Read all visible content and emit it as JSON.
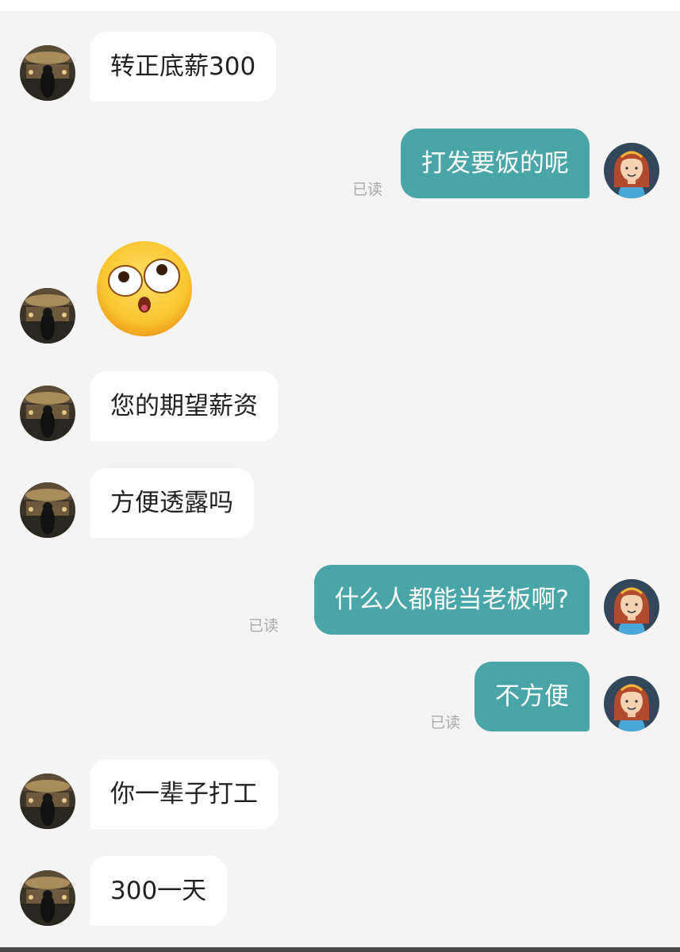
{
  "chat": {
    "read_label": "已读",
    "messages": [
      {
        "sender": "other",
        "text": "转正底薪300"
      },
      {
        "sender": "me",
        "text": "打发要饭的呢",
        "status": "已读"
      },
      {
        "sender": "other",
        "sticker": "eyes-rolling-surprised-face"
      },
      {
        "sender": "other",
        "text": "您的期望薪资"
      },
      {
        "sender": "other",
        "text": "方便透露吗"
      },
      {
        "sender": "me",
        "text": "什么人都能当老板啊?",
        "status": "已读"
      },
      {
        "sender": "me",
        "text": "不方便",
        "status": "已读"
      },
      {
        "sender": "other",
        "text": "你一辈子打工"
      },
      {
        "sender": "other",
        "text": "300一天"
      }
    ]
  },
  "colors": {
    "background": "#f4f4f4",
    "incoming_bubble": "#ffffff",
    "outgoing_bubble": "#4aa5a6",
    "read_text": "#a9a9a9"
  }
}
